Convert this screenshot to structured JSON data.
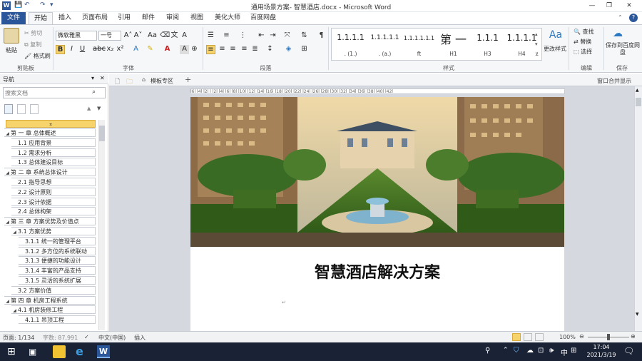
{
  "window": {
    "title": "通用场景方案- 智慧酒店.docx - Microsoft Word",
    "minimize": "—",
    "restore": "❐",
    "close": "✕",
    "help": "?"
  },
  "tabs": [
    "文件",
    "开始",
    "插入",
    "页面布局",
    "引用",
    "邮件",
    "审阅",
    "视图",
    "美化大师",
    "百度网盘"
  ],
  "ribbon": {
    "paste": "粘贴",
    "cut": "剪切",
    "copy": "复制",
    "format_painter": "格式刷",
    "clipboard_label": "剪贴板",
    "font_name": "微软雅黑",
    "font_size": "一号",
    "font_label": "字体",
    "paragraph_label": "段落",
    "styles_label": "样式",
    "change_styles": "更改样式",
    "find": "查找",
    "replace": "替换",
    "select": "选择",
    "editing_label": "编辑",
    "save_baidu": "保存到百度网盘",
    "save_label": "保存",
    "styles": [
      {
        "preview": "1.1.1.1",
        "name": ". (1.)"
      },
      {
        "preview": "1.1.1.1.1",
        "name": ". (a.)"
      },
      {
        "preview": "1.1.1.1.1.1",
        "name": "ft"
      },
      {
        "preview": "第 一",
        "name": "H1"
      },
      {
        "preview": "1.1.1",
        "name": "H3"
      },
      {
        "preview": "1.1.1.1",
        "name": "H4"
      }
    ]
  },
  "nav": {
    "title": "导航",
    "search_placeholder": "搜索文档",
    "items": [
      {
        "label": "第 一 章 总体概述",
        "level": 0
      },
      {
        "label": "1.1 应用背景",
        "level": 1
      },
      {
        "label": "1.2 需求分析",
        "level": 1
      },
      {
        "label": "1.3 总体建设目标",
        "level": 1
      },
      {
        "label": "第 二 章 系统总体设计",
        "level": 0
      },
      {
        "label": "2.1 指导思想",
        "level": 1
      },
      {
        "label": "2.2 设计原则",
        "level": 1
      },
      {
        "label": "2.3 设计依据",
        "level": 1
      },
      {
        "label": "2.4 总体构架",
        "level": 1
      },
      {
        "label": "第 三 章 方案优势及价值点",
        "level": 0
      },
      {
        "label": "3.1 方案优势",
        "level": 1
      },
      {
        "label": "3.1.1 统一的管理平台",
        "level": 2
      },
      {
        "label": "3.1.2 多方位的系统联动",
        "level": 2
      },
      {
        "label": "3.1.3 便捷的功能设计",
        "level": 2
      },
      {
        "label": "3.1.4 丰富的产品支持",
        "level": 2
      },
      {
        "label": "3.1.5 灵活的系统扩展",
        "level": 2
      },
      {
        "label": "3.2 方案价值",
        "level": 1
      },
      {
        "label": "第 四 章 机房工程系统",
        "level": 0
      },
      {
        "label": "4.1 机房装修工程",
        "level": 1
      },
      {
        "label": "4.1.1 吊顶工程",
        "level": 2
      }
    ]
  },
  "doc_tabs": {
    "template_area": "模板专区",
    "add": "+",
    "right": "窗口合并显示"
  },
  "ruler_text": "l6l  l4l  l2l   l  l2l  l4l  l6l  l8l  l10l  l12l  l14l  l16l  l18l  l20l  l22l  l24l  l26l  l28l  l30l  l32l  l34l  l36l  l38l  l40l  l42l",
  "document": {
    "title": "智慧酒店解决方案"
  },
  "status": {
    "page": "页面: 1/134",
    "words": "字数: 87,991",
    "lang": "中文(中国)",
    "mode": "插入",
    "zoom": "100%"
  },
  "taskbar": {
    "time": "17:04",
    "date": "2021/3/19",
    "ime": "中"
  },
  "colors": {
    "file_tab": "#2b579a",
    "taskbar": "#1a2235",
    "nav_highlight": "#f6d36b"
  }
}
